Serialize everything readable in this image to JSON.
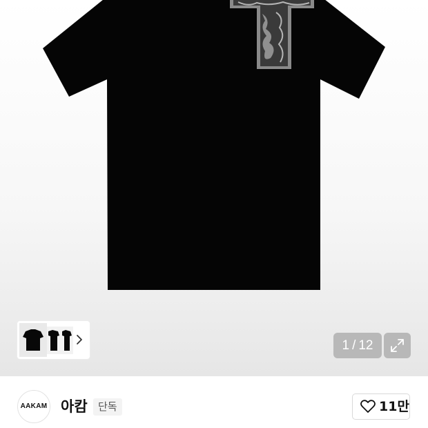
{
  "product": {
    "image_counter": {
      "current": "1",
      "separator": "/",
      "total": "12"
    }
  },
  "brand": {
    "logo_text": "AAKAM",
    "name": "아캄",
    "badge": "단독"
  },
  "like": {
    "count": "11만"
  },
  "icons": {
    "thumbnails_next": "chevron-right-icon",
    "fullscreen": "expand-icon",
    "like": "heart-icon"
  },
  "colors": {
    "shirt": "#050505",
    "print": "#8a8a8a",
    "overlay": "#afafaf"
  }
}
